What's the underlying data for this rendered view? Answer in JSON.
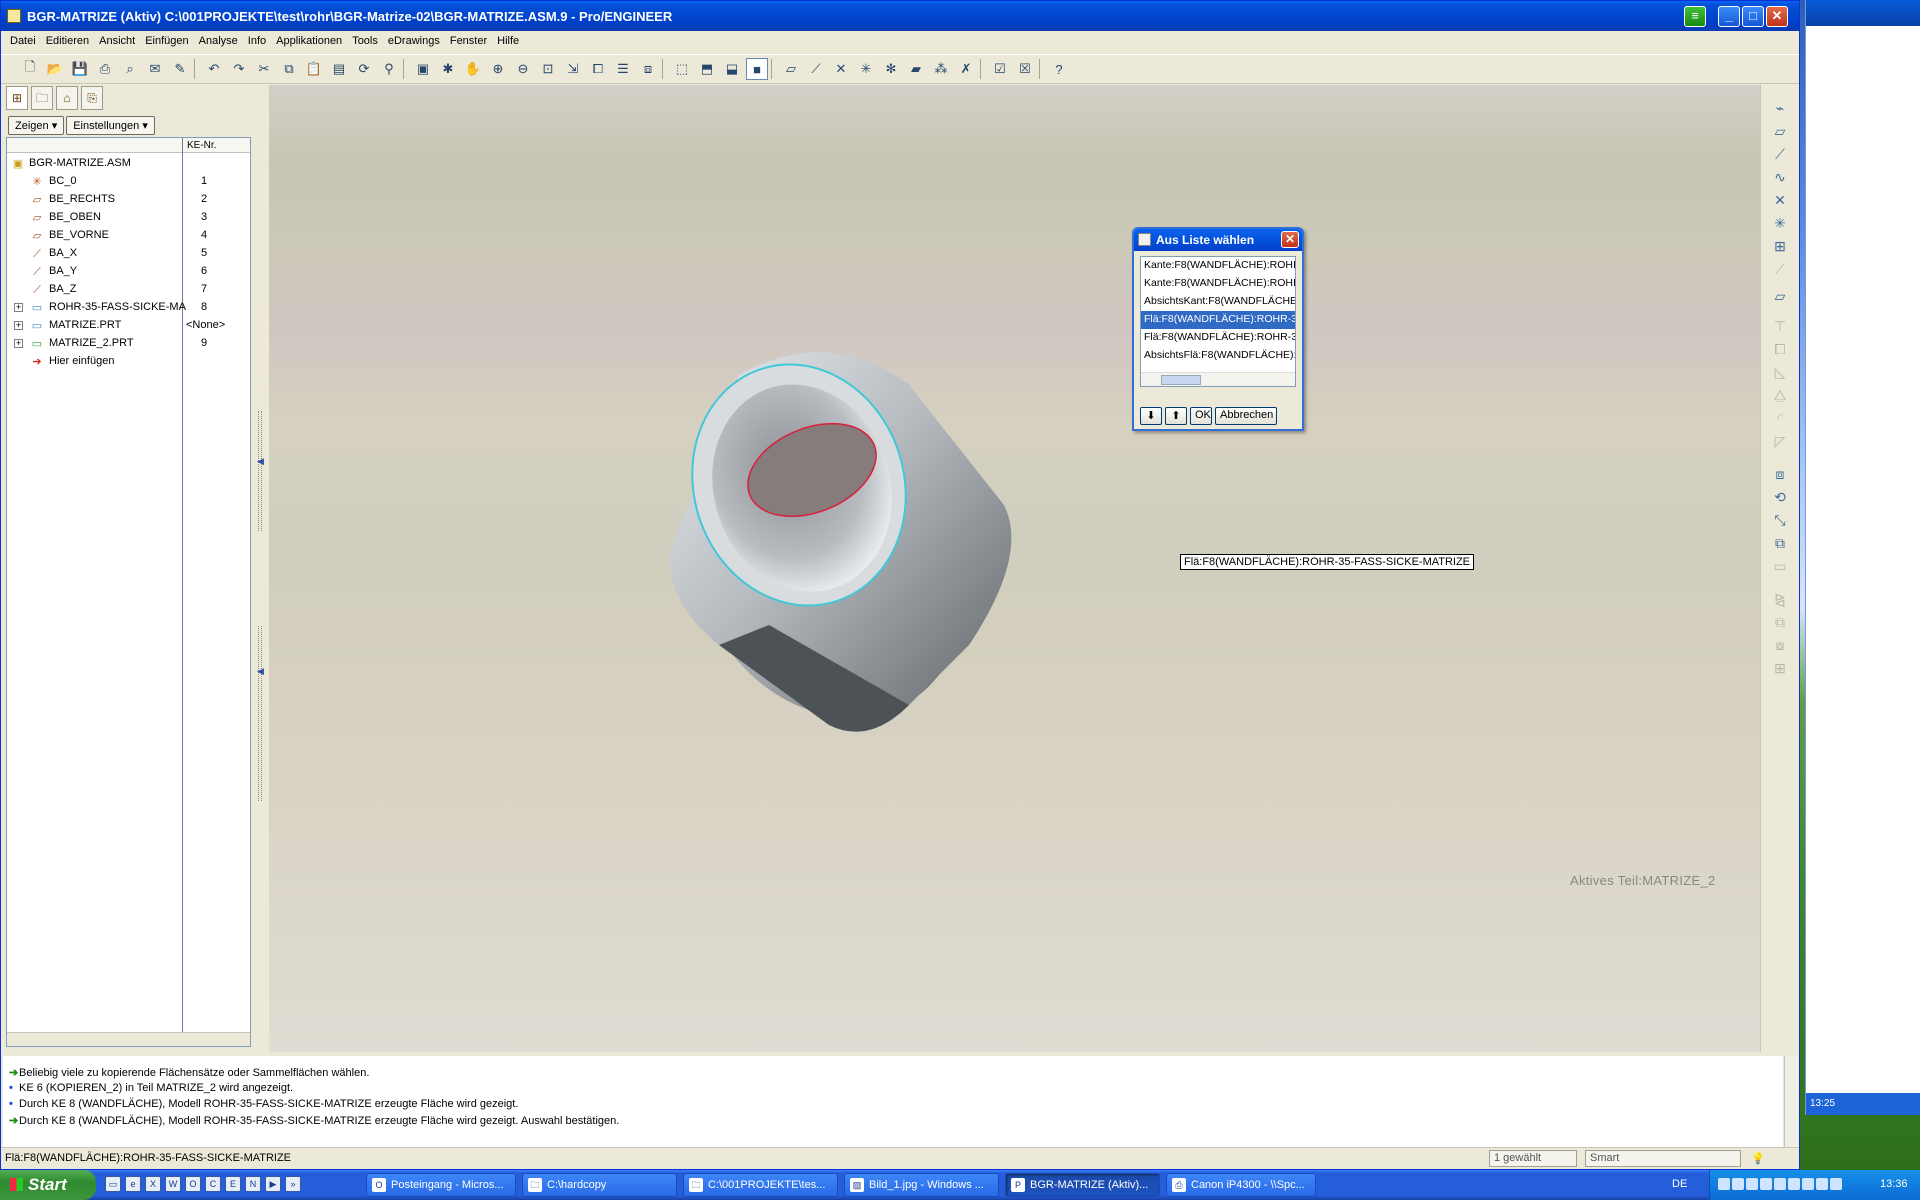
{
  "window": {
    "title": "BGR-MATRIZE (Aktiv) C:\\001PROJEKTE\\test\\rohr\\BGR-Matrize-02\\BGR-MATRIZE.ASM.9 - Pro/ENGINEER"
  },
  "menu": [
    "Datei",
    "Editieren",
    "Ansicht",
    "Einfügen",
    "Analyse",
    "Info",
    "Applikationen",
    "Tools",
    "eDrawings",
    "Fenster",
    "Hilfe"
  ],
  "toolbar_icons": [
    "new-icon",
    "open-icon",
    "save-icon",
    "print-icon",
    "print-preview-icon",
    "email-icon",
    "edit-icon",
    "undo-icon",
    "redo-icon",
    "cut-icon",
    "copy-icon",
    "paste-icon",
    "paste-special-icon",
    "regenerate-icon",
    "find-icon",
    "repaint-icon",
    "spin-center-icon",
    "pan-icon",
    "zoom-in-icon",
    "zoom-out-icon",
    "refit-icon",
    "orient-icon",
    "saved-views-icon",
    "layers-icon",
    "view-manager-icon",
    "wireframe-icon",
    "hidden-line-icon",
    "no-hidden-icon",
    "shading-icon",
    "datum-planes-icon",
    "datum-axes-icon",
    "point-symbols-icon",
    "coord-sys-icon",
    "spin-center-display-icon",
    "annotations-icon",
    "datum-points-icon",
    "window-activate-icon",
    "window-close-icon",
    "context-help-icon"
  ],
  "left_panel": {
    "zeigen_label": "Zeigen",
    "einstellungen_label": "Einstellungen",
    "col_header": "KE-Nr.",
    "tree": [
      {
        "name": "BGR-MATRIZE.ASM",
        "num": ""
      },
      {
        "name": "BC_0",
        "num": "1"
      },
      {
        "name": "BE_RECHTS",
        "num": "2"
      },
      {
        "name": "BE_OBEN",
        "num": "3"
      },
      {
        "name": "BE_VORNE",
        "num": "4"
      },
      {
        "name": "BA_X",
        "num": "5"
      },
      {
        "name": "BA_Y",
        "num": "6"
      },
      {
        "name": "BA_Z",
        "num": "7"
      },
      {
        "name": "ROHR-35-FASS-SICKE-MA",
        "num": "8"
      },
      {
        "name": "MATRIZE.PRT",
        "num": "<None>"
      },
      {
        "name": "MATRIZE_2.PRT",
        "num": "9"
      },
      {
        "name": "Hier einfügen",
        "num": ""
      }
    ]
  },
  "viewport": {
    "active_part": "Aktives Teil:MATRIZE_2",
    "tooltip": "Flä:F8(WANDFLÄCHE):ROHR-35-FASS-SICKE-MATRIZE"
  },
  "dialog": {
    "title": "Aus Liste wählen",
    "items": [
      "Kante:F8(WANDFLÄCHE):ROHI",
      "Kante:F8(WANDFLÄCHE):ROHI",
      "AbsichtsKant:F8(WANDFLÄCHE",
      "Flä:F8(WANDFLÄCHE):ROHR-3",
      "Flä:F8(WANDFLÄCHE):ROHR-3",
      "AbsichtsFlä:F8(WANDFLÄCHE):"
    ],
    "selected_index": 3,
    "ok_label": "OK",
    "cancel_label": "Abbrechen"
  },
  "messages": [
    "Beliebig viele zu kopierende Flächensätze oder Sammelflächen wählen.",
    "KE 6 (KOPIEREN_2) in Teil MATRIZE_2 wird angezeigt.",
    "Durch KE 8 (WANDFLÄCHE), Modell ROHR-35-FASS-SICKE-MATRIZE erzeugte Fläche wird gezeigt.",
    "Durch KE 8 (WANDFLÄCHE), Modell ROHR-35-FASS-SICKE-MATRIZE erzeugte Fläche wird gezeigt. Auswahl bestätigen."
  ],
  "status": {
    "text": "Flä:F8(WANDFLÄCHE):ROHR-35-FASS-SICKE-MATRIZE",
    "selected": "1 gewählt",
    "filter": "Smart"
  },
  "taskbar": {
    "start_label": "Start",
    "tasks": [
      "Posteingang - Micros...",
      "C:\\hardcopy",
      "C:\\001PROJEKTE\\tes...",
      "Bild_1.jpg - Windows ...",
      "BGR-MATRIZE (Aktiv)...",
      "Canon iP4300 - \\\\Spc..."
    ],
    "lang": "DE",
    "clock": "13:36",
    "second_clock": "13:25"
  },
  "colors": {
    "accent": "#0a63ef",
    "selection": "#316ac5",
    "highlight_edge": "#d8203c",
    "preselect_edge": "#40c8d8"
  }
}
